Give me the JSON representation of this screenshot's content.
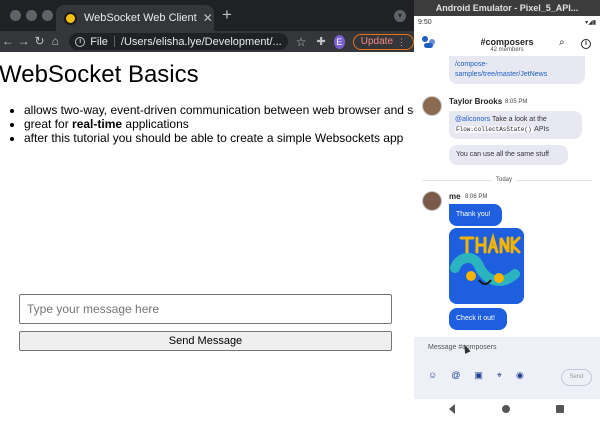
{
  "browser": {
    "tab_title": "WebSocket Web Client",
    "tab_close": "✕",
    "new_tab": "+",
    "scheme_label": "File",
    "url": "/Users/elisha.lye/Development/...",
    "profile_initial": "E",
    "update_label": "Update",
    "icons": [
      "back-icon",
      "forward-icon",
      "reload-icon",
      "home-icon",
      "info-icon",
      "star-icon",
      "extensions-icon",
      "menu-icon"
    ]
  },
  "page": {
    "heading": "WebSocket Basics",
    "bullets": [
      {
        "text": "allows two-way, event-driven communication between web browser and server",
        "bold": "",
        "suffix": ""
      },
      {
        "text": "great for ",
        "bold": "real-time",
        "suffix": " applications"
      },
      {
        "text": "after this tutorial you should be able to create a simple Websockets app",
        "bold": "",
        "suffix": ""
      }
    ],
    "input_placeholder": "Type your message here",
    "send_button": "Send Message"
  },
  "emulator": {
    "window_title": "Android Emulator - Pixel_5_API...",
    "status_time": "9:50",
    "channel_name": "#composers",
    "member_count": "42 members",
    "messages": {
      "prev_link": "/compose-samples/tree/master/JetNews",
      "author_1": "Taylor Brooks",
      "time_1": "8:05 PM",
      "mention": "@aliconors",
      "msg1_text": " Take a look at the ",
      "msg1_code": "Flow.collectAsState()",
      "msg1_suffix": " APIs",
      "msg2": "You can use all the same stuff",
      "day_label": "Today",
      "author_2": "me",
      "time_2": "8:06 PM",
      "msg3": "Thank you!",
      "msg4": "Check it out!"
    },
    "composer_placeholder": "Message #composers",
    "composer_send": "Send",
    "composer_icons": [
      "emoji-icon",
      "mention-icon",
      "image-icon",
      "location-icon",
      "chat-icon"
    ]
  },
  "colors": {
    "chrome_dark": "#202124",
    "chrome_toolbar": "#35363a",
    "update_accent": "#e8711a",
    "brand_blue": "#1e5fe0",
    "bubble_gray": "#e8e8f3"
  }
}
